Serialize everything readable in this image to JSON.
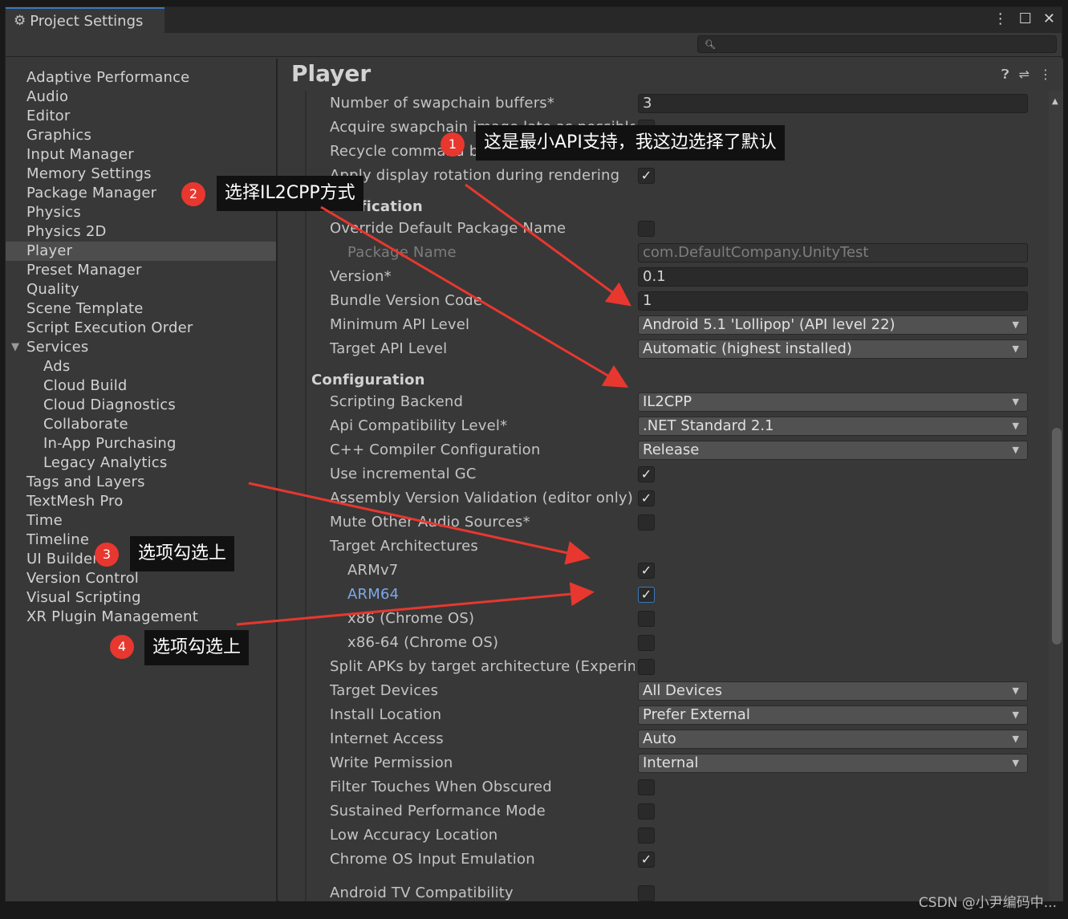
{
  "window": {
    "tab_title": "Project Settings",
    "search_placeholder": "",
    "menu_icon": "kebab-menu-icon",
    "maximize_icon": "maximize-icon",
    "close_icon": "close-icon"
  },
  "sidebar": {
    "items": [
      {
        "label": "Adaptive Performance",
        "level": 0
      },
      {
        "label": "Audio",
        "level": 0
      },
      {
        "label": "Editor",
        "level": 0
      },
      {
        "label": "Graphics",
        "level": 0
      },
      {
        "label": "Input Manager",
        "level": 0
      },
      {
        "label": "Memory Settings",
        "level": 0
      },
      {
        "label": "Package Manager",
        "level": 0
      },
      {
        "label": "Physics",
        "level": 0
      },
      {
        "label": "Physics 2D",
        "level": 0
      },
      {
        "label": "Player",
        "level": 0,
        "selected": true
      },
      {
        "label": "Preset Manager",
        "level": 0
      },
      {
        "label": "Quality",
        "level": 0
      },
      {
        "label": "Scene Template",
        "level": 0
      },
      {
        "label": "Script Execution Order",
        "level": 0
      },
      {
        "label": "Services",
        "level": 0,
        "expanded": true
      },
      {
        "label": "Ads",
        "level": 1
      },
      {
        "label": "Cloud Build",
        "level": 1
      },
      {
        "label": "Cloud Diagnostics",
        "level": 1
      },
      {
        "label": "Collaborate",
        "level": 1
      },
      {
        "label": "In-App Purchasing",
        "level": 1
      },
      {
        "label": "Legacy Analytics",
        "level": 1
      },
      {
        "label": "Tags and Layers",
        "level": 0
      },
      {
        "label": "TextMesh Pro",
        "level": 0
      },
      {
        "label": "Time",
        "level": 0
      },
      {
        "label": "Timeline",
        "level": 0
      },
      {
        "label": "UI Builder",
        "level": 0
      },
      {
        "label": "Version Control",
        "level": 0
      },
      {
        "label": "Visual Scripting",
        "level": 0
      },
      {
        "label": "XR Plugin Management",
        "level": 0
      }
    ]
  },
  "main": {
    "title": "Player",
    "header_icons": [
      "help-icon",
      "preset-icon",
      "kebab-menu-icon"
    ],
    "rows": [
      {
        "label": "Number of swapchain buffers*",
        "type": "field",
        "value": "3"
      },
      {
        "label": "Acquire swapchain image late as possible*",
        "type": "check",
        "checked": false
      },
      {
        "label": "Recycle command buffers*",
        "type": "check",
        "checked": true
      },
      {
        "label": "Apply display rotation during rendering",
        "type": "check",
        "checked": true
      },
      {
        "label": "Identification",
        "type": "section"
      },
      {
        "label": "Override Default Package Name",
        "type": "check",
        "checked": false
      },
      {
        "label": "Package Name",
        "type": "field",
        "value": "com.DefaultCompany.UnityTest",
        "dim": true,
        "indent": true
      },
      {
        "label": "Version*",
        "type": "field",
        "value": "0.1"
      },
      {
        "label": "Bundle Version Code",
        "type": "field",
        "value": "1"
      },
      {
        "label": "Minimum API Level",
        "type": "dropdown",
        "value": "Android 5.1 'Lollipop' (API level 22)"
      },
      {
        "label": "Target API Level",
        "type": "dropdown",
        "value": "Automatic (highest installed)"
      },
      {
        "label": "Configuration",
        "type": "section"
      },
      {
        "label": "Scripting Backend",
        "type": "dropdown",
        "value": "IL2CPP"
      },
      {
        "label": "Api Compatibility Level*",
        "type": "dropdown",
        "value": ".NET Standard 2.1"
      },
      {
        "label": "C++ Compiler Configuration",
        "type": "dropdown",
        "value": "Release"
      },
      {
        "label": "Use incremental GC",
        "type": "check",
        "checked": true
      },
      {
        "label": "Assembly Version Validation (editor only)",
        "type": "check",
        "checked": true
      },
      {
        "label": "Mute Other Audio Sources*",
        "type": "check",
        "checked": false
      },
      {
        "label": "Target Architectures",
        "type": "label"
      },
      {
        "label": "ARMv7",
        "type": "check",
        "checked": true,
        "indent": true
      },
      {
        "label": "ARM64",
        "type": "check",
        "checked": true,
        "indent": true,
        "highlight": true
      },
      {
        "label": "x86 (Chrome OS)",
        "type": "check",
        "checked": false,
        "indent": true
      },
      {
        "label": "x86-64 (Chrome OS)",
        "type": "check",
        "checked": false,
        "indent": true
      },
      {
        "label": "Split APKs by target architecture (Experimental)",
        "type": "check",
        "checked": false
      },
      {
        "label": "Target Devices",
        "type": "dropdown",
        "value": "All Devices"
      },
      {
        "label": "Install Location",
        "type": "dropdown",
        "value": "Prefer External"
      },
      {
        "label": "Internet Access",
        "type": "dropdown",
        "value": "Auto"
      },
      {
        "label": "Write Permission",
        "type": "dropdown",
        "value": "Internal"
      },
      {
        "label": "Filter Touches When Obscured",
        "type": "check",
        "checked": false
      },
      {
        "label": "Sustained Performance Mode",
        "type": "check",
        "checked": false
      },
      {
        "label": "Low Accuracy Location",
        "type": "check",
        "checked": false
      },
      {
        "label": "Chrome OS Input Emulation",
        "type": "check",
        "checked": true
      },
      {
        "label": "Android TV Compatibility",
        "type": "check",
        "checked": false
      }
    ]
  },
  "annotations": {
    "callouts": [
      {
        "num": "1",
        "text": "这是最小API支持，我这边选择了默认"
      },
      {
        "num": "2",
        "text": "选择IL2CPP方式"
      },
      {
        "num": "3",
        "text": "选项勾选上"
      },
      {
        "num": "4",
        "text": "选项勾选上"
      }
    ],
    "arrow_color": "#e8372f"
  },
  "watermark": "CSDN @小尹编码中..."
}
